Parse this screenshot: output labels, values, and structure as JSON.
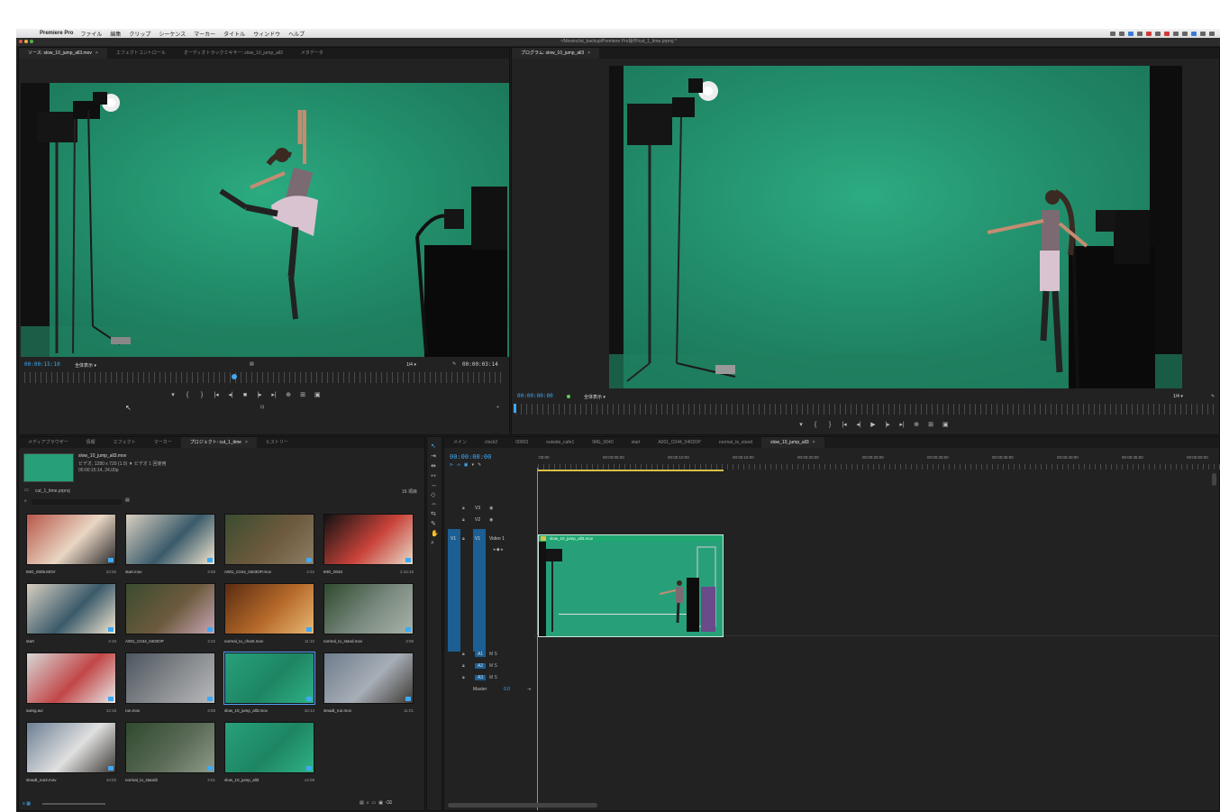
{
  "menubar": {
    "app_name": "Premiere Pro",
    "items": [
      "ファイル",
      "編集",
      "クリップ",
      "シーケンス",
      "マーカー",
      "タイトル",
      "ウィンドウ",
      "ヘルプ"
    ]
  },
  "window_title": "~/Movies/ist_backup/Premiere Pro操作/cut_1_time.prproj *",
  "source_monitor": {
    "tabs": [
      "ソース: slow_10_jump_all3.mov",
      "エフェクトコントロール",
      "オーディオトラックミキサー: slow_10_jump_all3",
      "メタデータ"
    ],
    "timecode_current": "00:00:15:10",
    "fit_label": "全体表示",
    "resolution_label": "1/4",
    "timecode_duration": "00:00:03:14"
  },
  "program_monitor": {
    "tab": "プログラム: slow_10_jump_all3",
    "timecode_current": "00:00:00:00",
    "fit_label": "全体表示",
    "resolution_label": "1/4"
  },
  "project_panel": {
    "tabs": [
      "メディアブラウザー",
      "情報",
      "エフェクト",
      "マーカー",
      "プロジェクト: cut_1_time",
      "ヒストリー"
    ],
    "preview_clip_name": "slow_10_jump_all3.mov",
    "preview_clip_info": "ビデオ, 1280 x 720 (1.0) ▼ ビデオ 1 回使用",
    "preview_clip_timing": "00:00:15:14, 24,00p",
    "project_file": "cut_1_time.prproj",
    "item_count": "16 項目",
    "clips": [
      {
        "name": "IMG_0005.MOV",
        "duration": "23:26"
      },
      {
        "name": "start.mov",
        "duration": "3:08"
      },
      {
        "name": "A001_C044_0403OP.mov",
        "duration": "4:22"
      },
      {
        "name": "IMG_0040",
        "duration": "2:16:18"
      },
      {
        "name": "start",
        "duration": "4:18"
      },
      {
        "name": "A001_C044_0403OP",
        "duration": "4:22"
      },
      {
        "name": "normal_to_chant.mov",
        "duration": "11:10"
      },
      {
        "name": "normal_to_stand.mov",
        "duration": "3:08"
      },
      {
        "name": "swing.avi",
        "duration": "12:18"
      },
      {
        "name": "run.mov",
        "duration": "3:08"
      },
      {
        "name": "slow_10_jump_all3.mov",
        "duration": "15:14"
      },
      {
        "name": "stnadt_run.mov",
        "duration": "11:01"
      },
      {
        "name": "stnadt_run2.mov",
        "duration": "10:02"
      },
      {
        "name": "normal_to_stand2",
        "duration": "3:01"
      },
      {
        "name": "slow_10_jump_all3",
        "duration": "14:08"
      }
    ]
  },
  "timeline": {
    "tabs": [
      "メイン",
      "clock2",
      "00003",
      "outside_cafe1",
      "IMG_0040",
      "start",
      "A001_C044_0403OP",
      "normal_to_stand",
      "slow_10_jump_all3"
    ],
    "timecode": "00:00:00:00",
    "ruler_labels": [
      ":00:00",
      "00:00:05:00",
      "00:00:10:00",
      "00:00:15:00",
      "00:00:20:00",
      "00:00:25:00",
      "00:00:30:00",
      "00:00:35:00",
      "00:00:40:00",
      "00:00:45:00",
      "00:00:50:00"
    ],
    "video_tracks": [
      "V3",
      "V2",
      "V1"
    ],
    "video1_label": "Video 1",
    "audio_tracks": [
      "A1",
      "A2",
      "A3"
    ],
    "master_label": "Master",
    "master_value": "0.0",
    "clip_name": "slow_10_jump_all3.mov"
  },
  "colors": {
    "accent_blue": "#3fa9f5",
    "panel_bg": "#222222",
    "green_screen": "#27a07a",
    "clip_label_green": "#1fa872"
  }
}
